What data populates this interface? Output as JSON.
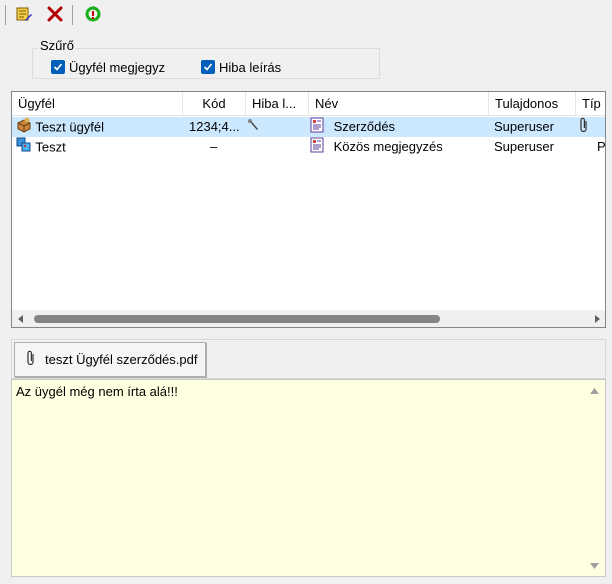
{
  "toolbar": {
    "buttons": [
      {
        "name": "edit-note-button",
        "icon": "note-pen-icon"
      },
      {
        "name": "delete-button",
        "icon": "red-x-icon"
      },
      {
        "name": "refresh-button",
        "icon": "green-refresh-icon"
      }
    ]
  },
  "filter": {
    "legend": "Szűrő",
    "options": [
      {
        "label": "Ügyfél megjegyz",
        "checked": true
      },
      {
        "label": "Hiba leírás",
        "checked": true
      }
    ]
  },
  "grid": {
    "columns": [
      "Ügyfél",
      "Kód",
      "Hiba l...",
      "Név",
      "Tulajdonos",
      "Típ"
    ],
    "rows": [
      {
        "ugyfel": "Teszt ügyfél",
        "ugyfel_icon": "box-client-icon",
        "kod": "1234;4...",
        "hiba_icon": "wrench-icon",
        "nev": "Szerződés",
        "nev_icon": "document-icon",
        "tulajdonos": "Superuser",
        "tip_icon": "paperclip-icon",
        "selected": true
      },
      {
        "ugyfel": "Teszt",
        "ugyfel_icon": "copy-items-icon",
        "kod": "–",
        "hiba_icon": "",
        "nev": "Közös megjegyzés",
        "nev_icon": "document-icon",
        "tulajdonos": "Superuser",
        "tip": "P",
        "selected": false
      }
    ]
  },
  "attachment": {
    "filename": "teszt Ügyfél szerződés.pdf",
    "icon": "paperclip-icon"
  },
  "memo": {
    "text": "Az üygél még nem írta alá!!!"
  },
  "colors": {
    "selection": "#cce8ff",
    "memo_background": "#ffffe1",
    "checkbox": "#005fb8"
  }
}
